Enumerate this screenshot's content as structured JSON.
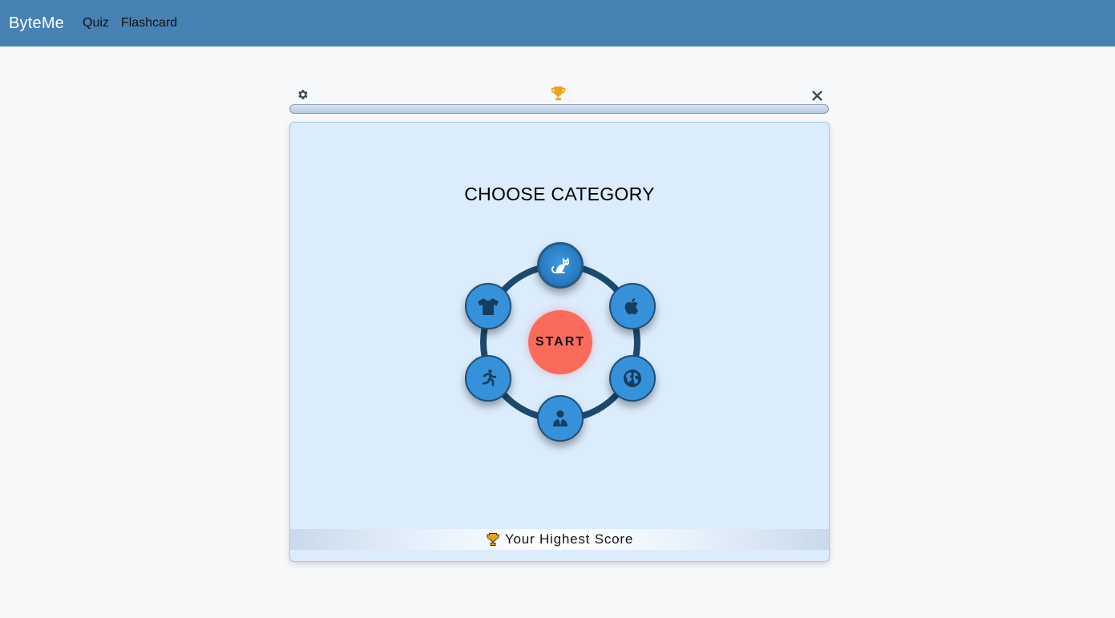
{
  "navbar": {
    "brand": "ByteMe",
    "links": [
      "Quiz",
      "Flashcard"
    ]
  },
  "toolbar": {
    "settings_icon": "gear-icon",
    "trophy_icon": "trophy-icon",
    "close_icon": "close-icon"
  },
  "progress": {
    "value": 0
  },
  "card": {
    "title": "CHOOSE CATEGORY",
    "start_label": "START",
    "categories": [
      {
        "icon": "cat-icon",
        "selected": true
      },
      {
        "icon": "apple-icon",
        "selected": false
      },
      {
        "icon": "globe-icon",
        "selected": false
      },
      {
        "icon": "businessman-icon",
        "selected": false
      },
      {
        "icon": "running-person-icon",
        "selected": false
      },
      {
        "icon": "tshirt-icon",
        "selected": false
      }
    ],
    "highest_score_label": "Your Highest Score"
  },
  "colors": {
    "navbar": "#4682b4",
    "card_bg": "#dbecfd",
    "ring": "#1c4a6e",
    "category_button": "#3691db",
    "start_button": "#fb6b5b",
    "trophy": "#e8a317",
    "settings_icon": "#2f4f4f"
  }
}
